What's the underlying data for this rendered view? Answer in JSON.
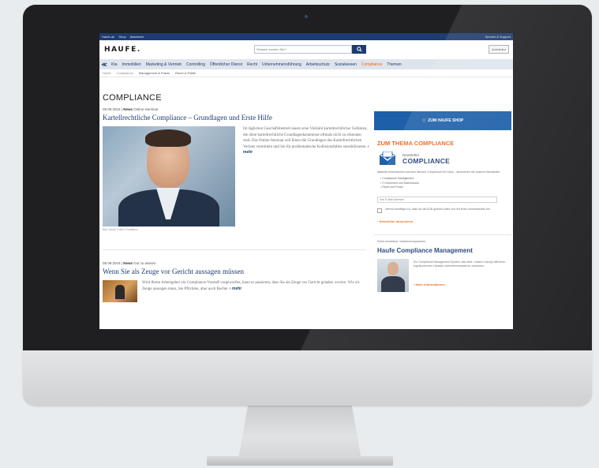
{
  "header": {
    "top_left": [
      "Haufe.de",
      "Shop",
      "Akademie"
    ],
    "top_right": "Service & Support",
    "logo": "HAUFE.",
    "search_placeholder": "Wonach suchen Sie?",
    "search_icon": "search-icon",
    "login_label": "Anmelden"
  },
  "nav": {
    "arrow": "≪",
    "items": [
      {
        "label": "Kta",
        "active": false
      },
      {
        "label": "Immobilien",
        "active": false
      },
      {
        "label": "Marketing & Vertrieb",
        "active": false
      },
      {
        "label": "Controlling",
        "active": false
      },
      {
        "label": "Öffentlicher Dienst",
        "active": false
      },
      {
        "label": "Recht",
        "active": false
      },
      {
        "label": "Unternehmensführung",
        "active": false
      },
      {
        "label": "Arbeitsschutz",
        "active": false
      },
      {
        "label": "Sozialwesen",
        "active": false
      },
      {
        "label": "Compliance",
        "active": true
      },
      {
        "label": "Themen",
        "active": false
      }
    ]
  },
  "subnav": [
    "Haufe",
    "Compliance",
    "Management & Praxis",
    "Recht & Politik"
  ],
  "page_title": "COMPLIANCE",
  "article1": {
    "date": "08.09.2016",
    "type": "News",
    "category": "Online-Seminar",
    "headline": "Kartellrechtliche Compliance – Grundlagen und Erste Hilfe",
    "body": "Im täglichen Geschäftsbetrieb lauern eine Vielzahl kartellrechtlicher Gefahren, die ohne kartellrechtliche Grundlagenkenntnisse oftmals nicht zu erkennen sind. Das Online-Seminar soll Ihnen die Grundlagen des Kartellrechtlichen Verbots vermitteln und Sie für problematische Kollisionsfallen sensibilisieren.",
    "more": "› mehr",
    "caption": "Bild: Haufe Online Redaktion"
  },
  "article2": {
    "date": "08.09.2016",
    "type": "News",
    "category": "Gut zu wissen",
    "headline": "Wenn Sie als Zeuge vor Gericht aussagen müssen",
    "body": "Wird Ihrem Arbeitgeber ein Compliance-Verstoß vorgeworfen, kann es passieren, dass Sie als Zeuge vor Gericht geladen werden. Wie als Zeuge aussagen muss, Sie Pflichten, aber auch Rechte.",
    "more": "› mehr"
  },
  "sidebar": {
    "shop_button": "🛒 ZUM HAUFE SHOP",
    "section_title": "ZUM THEMA COMPLIANCE",
    "newsletter_small": "Newsletter",
    "newsletter_big": "COMPLIANCE",
    "newsletter_icon": "envelope-icon",
    "newsletter_desc": "Aktuelle Informationen aus dem Bereich Compliance frei Haus – abonnieren Sie unseren Newsletter:",
    "newsletter_items": [
      "Compliance-Management",
      "IT-Sicherheit und Datenschutz",
      "Recht und Praxis"
    ],
    "email_placeholder": "Ihre E-Mail-Adresse",
    "consent": "Hiermit bestätige ich, dass ich die AGB gelesen habe und mit ihnen einverstanden bin.",
    "subscribe": "› Newsletter abonnieren",
    "kicker": "Sofort einsetzbar, individuell anpassbar.",
    "promo_title": "Haufe Compliance Management",
    "promo_text": "Ein Compliance Management System, das wirkt. Unsere Lösung hilft Ihnen, regelkonformes Handeln unternehmensweit zu verankern.",
    "promo_link": "› Mehr Informationen"
  }
}
